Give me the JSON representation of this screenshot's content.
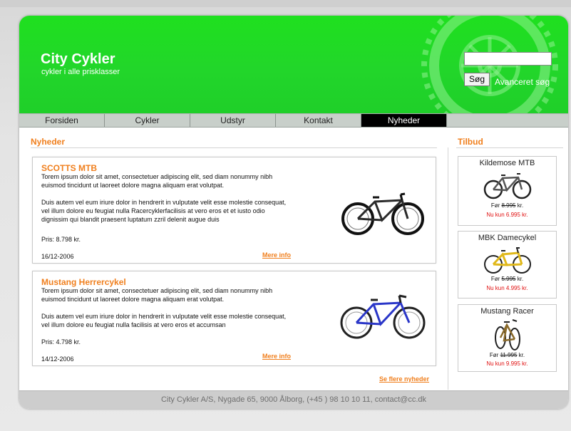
{
  "brand": {
    "title": "City Cykler",
    "subtitle": "cykler i alle prisklasser"
  },
  "search": {
    "placeholder": "",
    "button_label": "Søg",
    "advanced_label": "Avanceret søg"
  },
  "nav": {
    "items": [
      {
        "label": "Forsiden"
      },
      {
        "label": "Cykler"
      },
      {
        "label": "Udstyr"
      },
      {
        "label": "Kontakt"
      },
      {
        "label": "Nyheder"
      }
    ],
    "active": "Nyheder"
  },
  "news_section": {
    "title": "Nyheder",
    "items": [
      {
        "title": "SCOTTS MTB",
        "para1": "Torem ipsum dolor sit amet, consectetuer adipiscing elit, sed diam nonummy nibh euismod tincidunt ut laoreet dolore magna aliquam erat volutpat.",
        "para2": "Duis autem vel eum iriure dolor in hendrerit in vulputate velit esse molestie consequat, vel illum dolore eu feugiat nulla Racercyklerfacilisis at vero eros et et iusto odio dignissim qui blandit praesent luptatum zzril delenit augue duis",
        "price": "Pris: 8.798 kr.",
        "date": "16/12-2006",
        "more": "Mere info"
      },
      {
        "title": "Mustang Herrercykel",
        "para1": "Torem ipsum dolor sit amet, consectetuer adipiscing elit, sed diam nonummy nibh euismod tincidunt ut laoreet dolore magna aliquam erat volutpat.",
        "para2": "Duis autem vel eum iriure dolor in hendrerit in vulputate velit esse molestie consequat, vel illum dolore eu feugiat nulla facilisis at vero eros et accumsan",
        "price": "Pris: 4.798 kr.",
        "date": "14/12-2006",
        "more": "Mere info"
      }
    ],
    "see_more": "Se flere nyheder"
  },
  "offers": {
    "title": "Tilbud",
    "items": [
      {
        "name": "Kildemose MTB",
        "before_prefix": "Før ",
        "before_price": "8.995",
        "before_suffix": " kr.",
        "now": "Nu kun 6.995 kr."
      },
      {
        "name": "MBK Damecykel",
        "before_prefix": "Før ",
        "before_price": "5.995",
        "before_suffix": " kr.",
        "now": "Nu kun 4.995 kr."
      },
      {
        "name": "Mustang Racer",
        "before_prefix": "Før ",
        "before_price": "11.995",
        "before_suffix": " kr.",
        "now": "Nu kun 9.995 kr."
      }
    ]
  },
  "footer": {
    "text": "City Cykler A/S, Nygade 65, 9000 Ålborg, (+45 ) 98 10 10 11, contact@cc.dk"
  },
  "colors": {
    "header_green": "#22d62a",
    "accent_orange": "#f07f1d",
    "offer_red": "#e01010",
    "nav_active": "#000000"
  }
}
